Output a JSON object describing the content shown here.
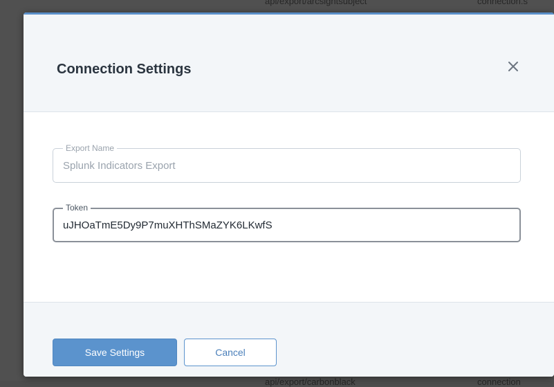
{
  "background": {
    "top_text_1": "api/export/arcsightsubject",
    "top_text_2": "connection.s",
    "bottom_text_1": "api/export/carbonblack",
    "bottom_text_2": "connection"
  },
  "dialog": {
    "title": "Connection Settings",
    "close_icon": "close-icon",
    "fields": [
      {
        "label": "Export Name",
        "value": "Splunk Indicators Export"
      },
      {
        "label": "Token",
        "value": "uJHOaTmE5Dy9P7muXHThSMaZYK6LKwfS"
      }
    ],
    "buttons": {
      "save_label": "Save Settings",
      "cancel_label": "Cancel"
    }
  },
  "colors": {
    "accent": "#5b93cd",
    "header_bg": "#f3f6f9",
    "title_text": "#2b3540",
    "overlay": "#505050"
  }
}
